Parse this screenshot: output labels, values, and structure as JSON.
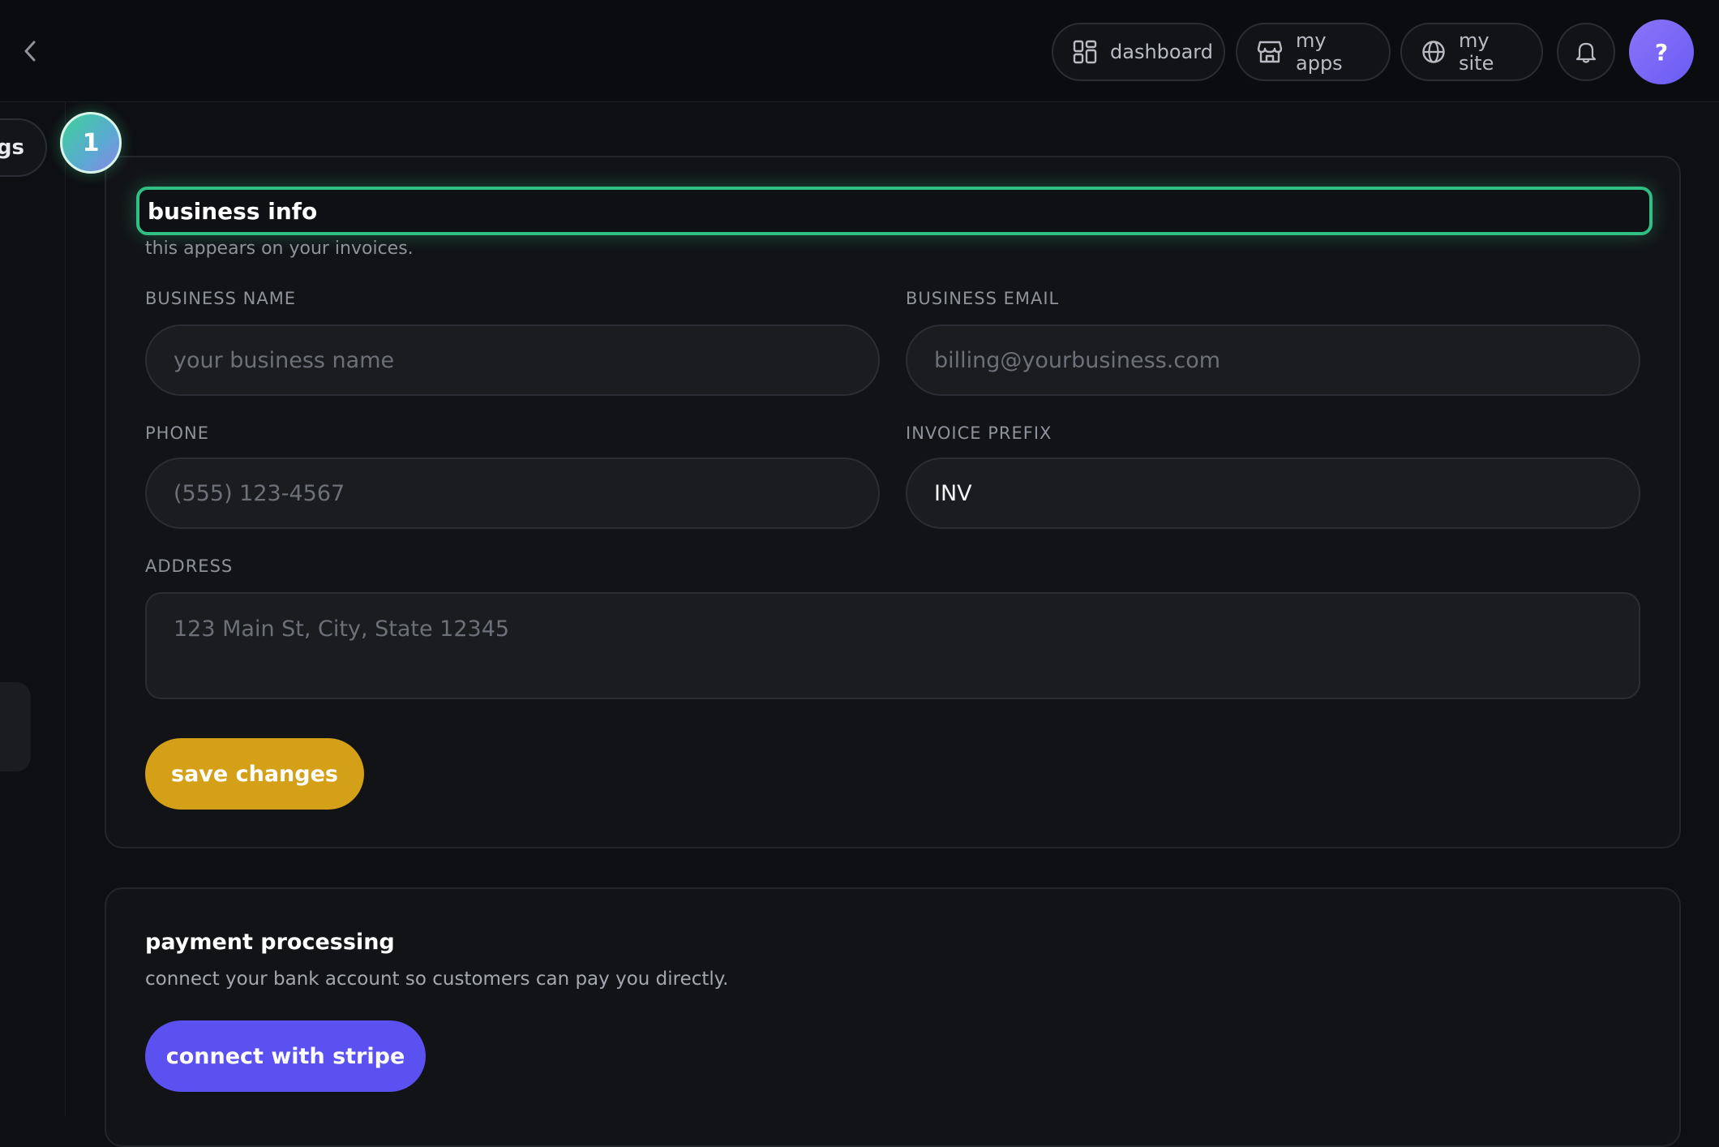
{
  "topbar": {
    "nav": {
      "dashboard": "dashboard",
      "my_apps": "my apps",
      "my_site": "my site"
    },
    "help_label": "?"
  },
  "sidebar": {
    "tab_label": "gs"
  },
  "step_badge": "1",
  "business_info": {
    "title": "business info",
    "subtitle": "this appears on your invoices.",
    "fields": {
      "business_name": {
        "label": "BUSINESS NAME",
        "placeholder": "your business name",
        "value": ""
      },
      "business_email": {
        "label": "BUSINESS EMAIL",
        "placeholder": "billing@yourbusiness.com",
        "value": ""
      },
      "phone": {
        "label": "PHONE",
        "placeholder": "(555) 123-4567",
        "value": ""
      },
      "invoice_prefix": {
        "label": "INVOICE PREFIX",
        "placeholder": "",
        "value": "INV"
      },
      "address": {
        "label": "ADDRESS",
        "placeholder": "123 Main St, City, State 12345",
        "value": ""
      }
    },
    "save_label": "save changes"
  },
  "payment": {
    "title": "payment processing",
    "subtitle": "connect your bank account so customers can pay you directly.",
    "connect_label": "connect with stripe"
  },
  "colors": {
    "accent_green": "#2fbf85",
    "save_gold": "#d4a017",
    "stripe_purple": "#5b50f0",
    "help_purple": "#7b68f6"
  },
  "icons": {
    "back": "chevron-left-icon",
    "dashboard": "grid-icon",
    "my_apps": "store-icon",
    "my_site": "globe-icon",
    "notifications": "bell-icon"
  }
}
